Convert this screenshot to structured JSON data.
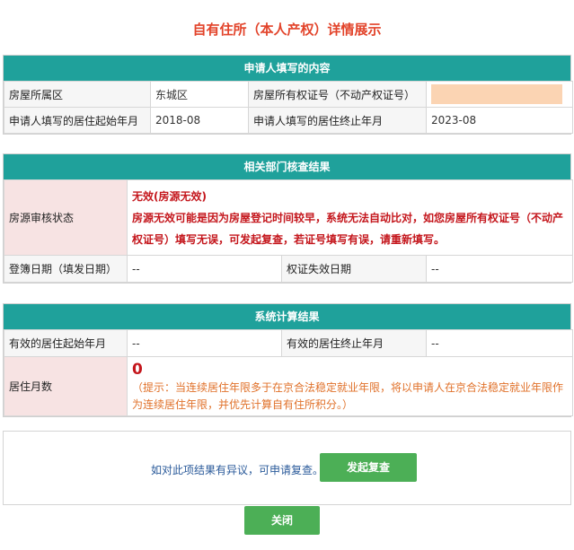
{
  "title": "自有住所（本人产权）详情展示",
  "section_applicant": {
    "header": "申请人填写的内容",
    "rows": [
      {
        "label1": "房屋所属区",
        "value1": "东城区",
        "label2": "房屋所有权证号（不动产权证号）",
        "value2": ""
      },
      {
        "label1": "申请人填写的居住起始年月",
        "value1": "2018-08",
        "label2": "申请人填写的居住终止年月",
        "value2": "2023-08"
      }
    ]
  },
  "section_check": {
    "header": "相关部门核查结果",
    "status_label": "房源审核状态",
    "status_value": "无效(房源无效)",
    "status_note": "房源无效可能是因为房屋登记时间较早，系统无法自动比对，如您房屋所有权证号（不动产权证号）填写无误，可发起复查，若证号填写有误，请重新填写。",
    "reg_date_label": "登簿日期（填发日期）",
    "reg_date_value": "--",
    "expire_label": "权证失效日期",
    "expire_value": "--"
  },
  "section_calc": {
    "header": "系统计算结果",
    "start_label": "有效的居住起始年月",
    "start_value": "--",
    "end_label": "有效的居住终止年月",
    "end_value": "--",
    "months_label": "居住月数",
    "months_value": "0",
    "tip": "（提示：当连续居住年限多于在京合法稳定就业年限，将以申请人在京合法稳定就业年限作为连续居住年限，并优先计算自有住所积分。）"
  },
  "bottom": {
    "note": "如对此项结果有异议，可申请复查。",
    "review_button": "发起复查",
    "close_button": "关闭"
  },
  "colors": {
    "header_bg": "#1fa19b",
    "title": "#e2432a",
    "warning_red": "#c4161c",
    "tip_orange": "#e0712a",
    "button_green": "#4caf56",
    "redaction": "#fbd4b3"
  }
}
